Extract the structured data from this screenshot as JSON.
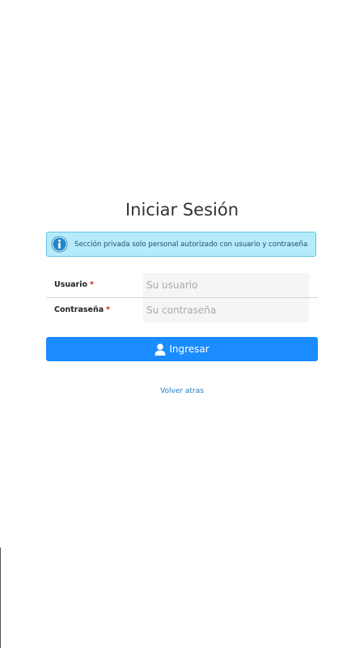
{
  "page": {
    "title": "Iniciar Sesión"
  },
  "alert": {
    "icon": "info-icon",
    "text": "Sección privada solo personal autorizado con usuario y contraseña",
    "background": "#b6ebfb",
    "border": "#5fc6e6"
  },
  "form": {
    "username": {
      "label": "Usuario",
      "required_marker": "*",
      "placeholder": "Su usuario",
      "value": ""
    },
    "password": {
      "label": "Contraseña",
      "required_marker": "*",
      "placeholder": "Su contraseña",
      "value": ""
    },
    "submit": {
      "icon": "user-icon",
      "label": "Ingresar",
      "color": "#1a8cff"
    }
  },
  "back_link": {
    "label": "Volver atras",
    "color": "#1a7fc4"
  }
}
